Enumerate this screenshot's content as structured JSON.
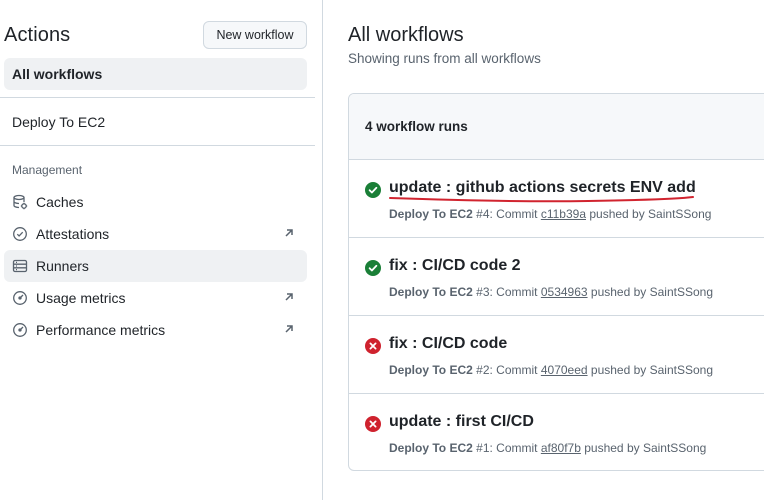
{
  "sidebar": {
    "title": "Actions",
    "new_workflow_label": "New workflow",
    "all_workflows_label": "All workflows",
    "workflows": [
      {
        "label": "Deploy To EC2"
      }
    ],
    "management_label": "Management",
    "management_items": [
      {
        "label": "Caches",
        "icon": "cache-icon",
        "external": false
      },
      {
        "label": "Attestations",
        "icon": "attestation-icon",
        "external": true
      },
      {
        "label": "Runners",
        "icon": "runners-icon",
        "external": false,
        "active": true
      },
      {
        "label": "Usage metrics",
        "icon": "meter-icon",
        "external": true
      },
      {
        "label": "Performance metrics",
        "icon": "meter-icon",
        "external": true
      }
    ]
  },
  "main": {
    "title": "All workflows",
    "subtitle": "Showing runs from all workflows",
    "runs_count_label": "4 workflow runs",
    "runs": [
      {
        "status": "success",
        "title": "update : github actions secrets ENV add",
        "workflow": "Deploy To EC2",
        "run_number": "#4",
        "commit_prefix": ": Commit",
        "sha": "c11b39a",
        "pushed_by": "pushed by SaintSSong"
      },
      {
        "status": "success",
        "title": "fix : CI/CD code 2",
        "workflow": "Deploy To EC2",
        "run_number": "#3",
        "commit_prefix": ": Commit",
        "sha": "0534963",
        "pushed_by": "pushed by SaintSSong"
      },
      {
        "status": "failure",
        "title": "fix : CI/CD code",
        "workflow": "Deploy To EC2",
        "run_number": "#2",
        "commit_prefix": ": Commit",
        "sha": "4070eed",
        "pushed_by": "pushed by SaintSSong"
      },
      {
        "status": "failure",
        "title": "update : first CI/CD",
        "workflow": "Deploy To EC2",
        "run_number": "#1",
        "commit_prefix": ": Commit",
        "sha": "af80f7b",
        "pushed_by": "pushed by SaintSSong"
      }
    ]
  },
  "colors": {
    "success": "#1a7f37",
    "failure": "#cf222e",
    "annotation": "#d1242f"
  }
}
